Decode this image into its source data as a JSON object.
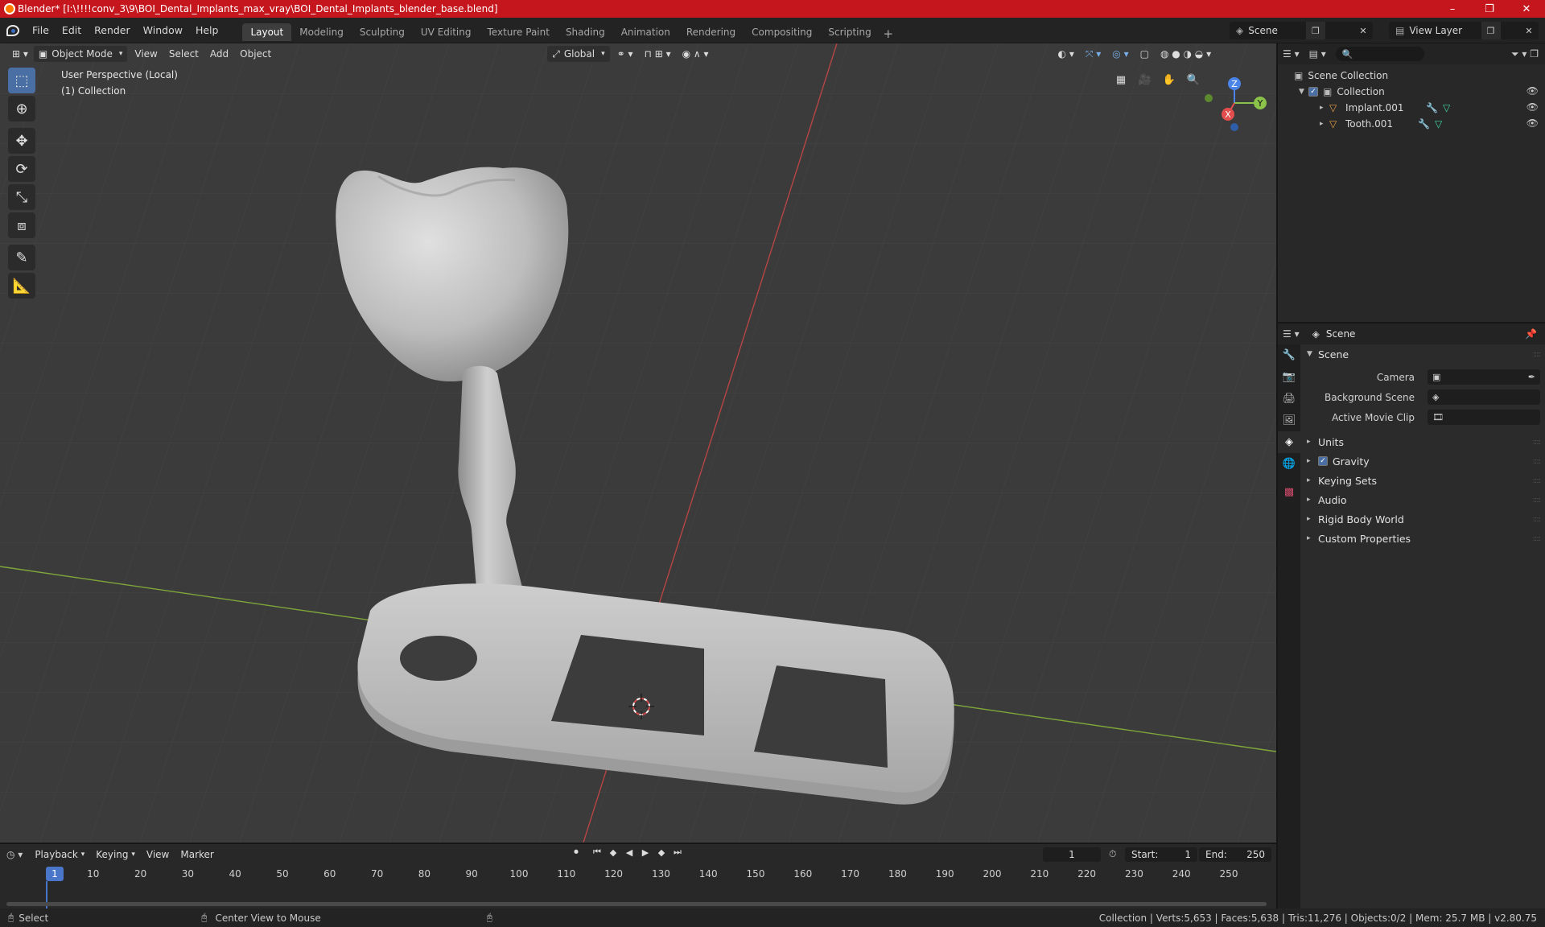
{
  "window": {
    "title": "Blender* [I:\\!!!!conv_3\\9\\BOI_Dental_Implants_max_vray\\BOI_Dental_Implants_blender_base.blend]",
    "minimize": "–",
    "maximize": "❐",
    "close": "✕"
  },
  "menu": {
    "items": [
      "File",
      "Edit",
      "Render",
      "Window",
      "Help"
    ],
    "workspaces": [
      "Layout",
      "Modeling",
      "Sculpting",
      "UV Editing",
      "Texture Paint",
      "Shading",
      "Animation",
      "Rendering",
      "Compositing",
      "Scripting"
    ],
    "active_workspace": "Layout",
    "add_workspace": "+",
    "scene_name": "Scene",
    "view_layer": "View Layer"
  },
  "viewport": {
    "mode": "Object Mode",
    "menus": [
      "View",
      "Select",
      "Add",
      "Object"
    ],
    "transform_orientation": "Global",
    "perspective_label": "User Perspective (Local)",
    "collection_label": "(1) Collection",
    "gizmo_axes": {
      "x": "X",
      "y": "Y",
      "z": "Z"
    }
  },
  "tools": [
    "select-box",
    "cursor",
    "move",
    "rotate",
    "scale",
    "transform",
    "annotate",
    "measure"
  ],
  "outliner": {
    "search_placeholder": "",
    "scene_collection": "Scene Collection",
    "collection": "Collection",
    "objects": [
      {
        "name": "Implant.001"
      },
      {
        "name": "Tooth.001"
      }
    ]
  },
  "properties": {
    "header": "Scene",
    "section_scene": "Scene",
    "fields": [
      {
        "label": "Camera"
      },
      {
        "label": "Background Scene"
      },
      {
        "label": "Active Movie Clip"
      }
    ],
    "sections": [
      "Units",
      "Gravity",
      "Keying Sets",
      "Audio",
      "Rigid Body World",
      "Custom Properties"
    ]
  },
  "timeline": {
    "menus": [
      "Playback",
      "Keying",
      "View",
      "Marker"
    ],
    "current_frame": "1",
    "start_label": "Start:",
    "start": "1",
    "end_label": "End:",
    "end": "250",
    "ticks": [
      "1",
      "10",
      "20",
      "30",
      "40",
      "50",
      "60",
      "70",
      "80",
      "90",
      "100",
      "110",
      "120",
      "130",
      "140",
      "150",
      "160",
      "170",
      "180",
      "190",
      "200",
      "210",
      "220",
      "230",
      "240",
      "250"
    ]
  },
  "status": {
    "left_action": "Select",
    "middle_action": "Center View to Mouse",
    "stats": "Collection | Verts:5,653 | Faces:5,638 | Tris:11,276 | Objects:0/2 | Mem: 25.7 MB | v2.80.75"
  }
}
